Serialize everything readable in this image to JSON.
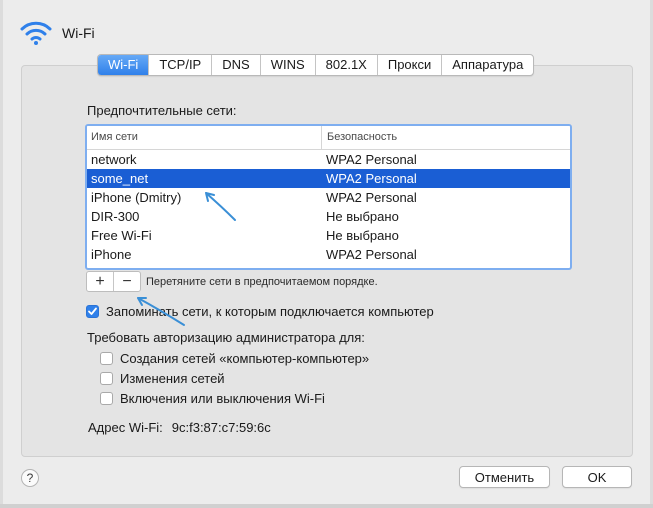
{
  "header": {
    "title": "Wi-Fi",
    "icon": "wifi-icon",
    "icon_color": "#2f80ea"
  },
  "tabs": [
    {
      "label": "Wi-Fi",
      "active": true
    },
    {
      "label": "TCP/IP"
    },
    {
      "label": "DNS"
    },
    {
      "label": "WINS"
    },
    {
      "label": "802.1X"
    },
    {
      "label": "Прокси"
    },
    {
      "label": "Аппаратура"
    }
  ],
  "networks": {
    "label": "Предпочтительные сети:",
    "columns": [
      "Имя сети",
      "Безопасность"
    ],
    "rows": [
      {
        "name": "network",
        "security": "WPA2 Personal"
      },
      {
        "name": "some_net",
        "security": "WPA2 Personal",
        "selected": true
      },
      {
        "name": "iPhone (Dmitry)",
        "security": "WPA2 Personal"
      },
      {
        "name": "DIR-300",
        "security": "Не выбрано"
      },
      {
        "name": "Free Wi-Fi",
        "security": "Не выбрано"
      },
      {
        "name": "iPhone",
        "security": "WPA2 Personal"
      }
    ],
    "add_label": "+",
    "remove_label": "−",
    "drag_hint": "Перетяните сети в предпочитаемом порядке.",
    "selection_color": "#1a5ed4"
  },
  "remember": {
    "label": "Запоминать сети, к которым подключается компьютер",
    "checked": true
  },
  "admin": {
    "label": "Требовать авторизацию администратора для:",
    "options": [
      {
        "label": "Создания сетей «компьютер-компьютер»",
        "checked": false
      },
      {
        "label": "Изменения сетей",
        "checked": false
      },
      {
        "label": "Включения или выключения Wi-Fi",
        "checked": false
      }
    ]
  },
  "wifi_address": {
    "label": "Адрес Wi-Fi:",
    "value": "9c:f3:87:c7:59:6c"
  },
  "footer": {
    "help_label": "?",
    "cancel_label": "Отменить",
    "ok_label": "OK"
  },
  "annotation_color": "#3a8fd6"
}
